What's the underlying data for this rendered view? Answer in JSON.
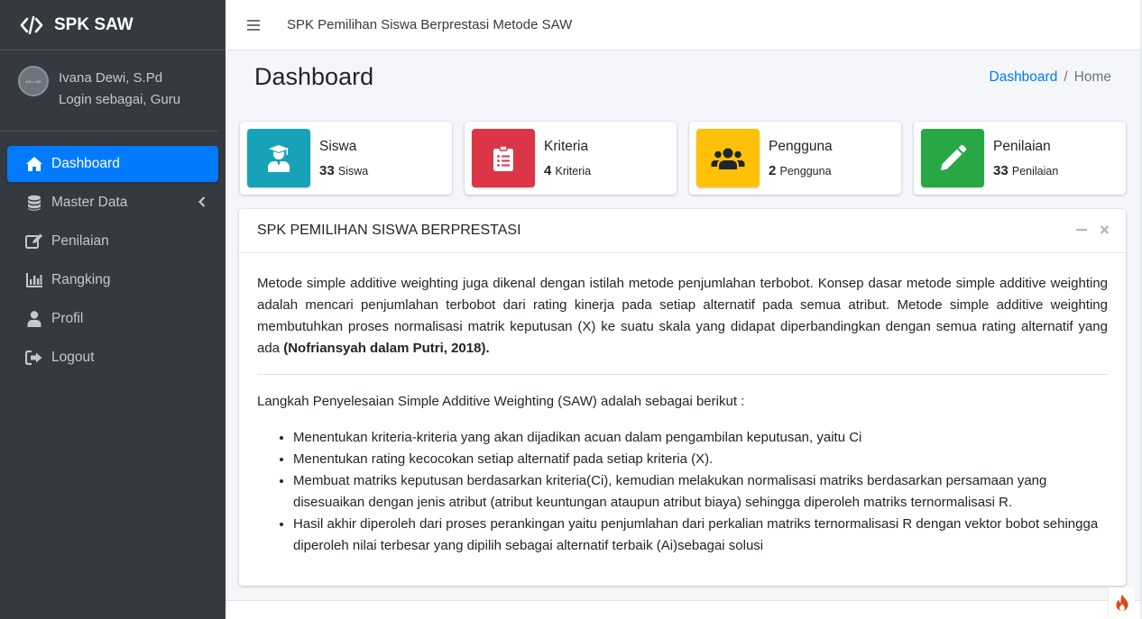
{
  "brand": {
    "name": "SPK SAW",
    "icon": "code-icon"
  },
  "user": {
    "avatar_text": "100 x 100",
    "name": "Ivana Dewi, S.Pd",
    "role": "Login sebagai, Guru"
  },
  "sidebar": {
    "items": [
      {
        "label": "Dashboard",
        "icon": "home-icon",
        "active": true
      },
      {
        "label": "Master Data",
        "icon": "database-icon",
        "has_caret": true
      },
      {
        "label": "Penilaian",
        "icon": "edit-icon"
      },
      {
        "label": "Rangking",
        "icon": "bar-chart-icon"
      },
      {
        "label": "Profil",
        "icon": "user-icon"
      },
      {
        "label": "Logout",
        "icon": "sign-out-icon"
      }
    ]
  },
  "topbar": {
    "title": "SPK Pemilihan Siswa Berprestasi Metode SAW"
  },
  "header": {
    "title": "Dashboard",
    "breadcrumb": {
      "link": "Dashboard",
      "sep": "/",
      "current": "Home"
    }
  },
  "info_boxes": [
    {
      "label": "Siswa",
      "count": "33",
      "unit": "Siswa",
      "color": "#17a2b8",
      "icon": "graduate-icon"
    },
    {
      "label": "Kriteria",
      "count": "4",
      "unit": "Kriteria",
      "color": "#dc3545",
      "icon": "clipboard-list-icon"
    },
    {
      "label": "Pengguna",
      "count": "2",
      "unit": "Pengguna",
      "color": "#ffc107",
      "icon": "users-icon"
    },
    {
      "label": "Penilaian",
      "count": "33",
      "unit": "Penilaian",
      "color": "#28a745",
      "icon": "pencil-icon"
    }
  ],
  "card": {
    "title": "SPK PEMILIHAN SISWA BERPRESTASI",
    "intro": "Metode simple additive weighting juga dikenal dengan istilah metode penjumlahan terbobot. Konsep dasar metode simple additive weighting adalah mencari penjumlahan terbobot dari rating kinerja pada setiap alternatif pada semua atribut. Metode simple additive weighting membutuhkan proses normalisasi matrik keputusan (X) ke suatu skala yang didapat diperbandingkan dengan semua rating alternatif yang ada",
    "citation": "(Nofriansyah dalam Putri, 2018).",
    "steps_title": "Langkah Penyelesaian Simple Additive Weighting (SAW) adalah sebagai berikut :",
    "steps": [
      "Menentukan kriteria-kriteria yang akan dijadikan acuan dalam pengambilan keputusan, yaitu Ci",
      "Menentukan rating kecocokan setiap alternatif pada setiap kriteria (X).",
      "Membuat matriks keputusan berdasarkan kriteria(Ci), kemudian melakukan normalisasi matriks berdasarkan persamaan yang disesuaikan dengan jenis atribut (atribut keuntungan ataupun atribut biaya) sehingga diperoleh matriks ternormalisasi R.",
      "Hasil akhir diperoleh dari proses perankingan yaitu penjumlahan dari perkalian matriks ternormalisasi R dengan vektor bobot sehingga diperoleh nilai terbesar yang dipilih sebagai alternatif terbaik (Ai)sebagai solusi"
    ]
  }
}
